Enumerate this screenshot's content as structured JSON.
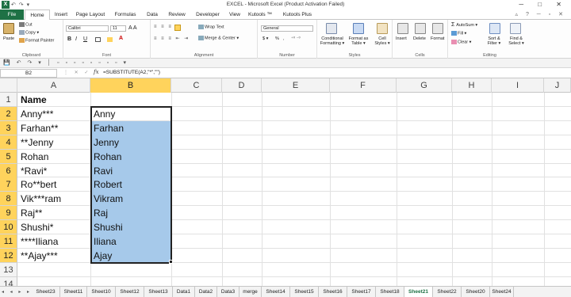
{
  "window": {
    "title": "EXCEL - Microsoft Excel (Product Activation Failed)",
    "quick_access": "↶ ↷ ▾",
    "controls": "─ □ ✕"
  },
  "tabs": [
    "File",
    "Home",
    "Insert",
    "Page Layout",
    "Formulas",
    "Data",
    "Review",
    "Developer",
    "View",
    "Kutools ™",
    "Kutools Plus"
  ],
  "active_tab": "Home",
  "ribbon": {
    "clipboard": {
      "paste": "Paste",
      "cut": "Cut",
      "copy": "Copy ▾",
      "format_painter": "Format Painter",
      "label": "Clipboard"
    },
    "font": {
      "name": "Calibri",
      "size": "11",
      "label": "Font",
      "bold": "B",
      "italic": "I",
      "underline": "U"
    },
    "alignment": {
      "wrap_text": "Wrap Text",
      "merge_center": "Merge & Center ▾",
      "label": "Alignment"
    },
    "number": {
      "format": "General",
      "label": "Number",
      "currency": "$ ▾",
      "percent": "%",
      "comma": ","
    },
    "styles": {
      "conditional": "Conditional Formatting ▾",
      "format_table": "Format as Table ▾",
      "cell_styles": "Cell Styles ▾",
      "label": "Styles"
    },
    "cells": {
      "insert": "Insert",
      "delete": "Delete",
      "format": "Format",
      "label": "Cells"
    },
    "editing": {
      "autosum": "AutoSum ▾",
      "fill": "Fill ▾",
      "clear": "Clear ▾",
      "sort_filter": "Sort & Filter ▾",
      "find_select": "Find & Select ▾",
      "label": "Editing"
    }
  },
  "formula_bar": {
    "name_box": "B2",
    "fx": "fx",
    "formula": "=SUBSTITUTE(A2,\"*\",\"\")"
  },
  "columns": [
    "A",
    "B",
    "C",
    "D",
    "E",
    "F",
    "G",
    "H",
    "I",
    "J"
  ],
  "rows": [
    "1",
    "2",
    "3",
    "4",
    "5",
    "6",
    "7",
    "8",
    "9",
    "10",
    "11",
    "12",
    "13",
    "14"
  ],
  "cells": {
    "A": [
      "Name",
      "Anny***",
      "Farhan**",
      "**Jenny",
      "Rohan",
      "*Ravi*",
      "Ro**bert",
      "Vik***ram",
      "Raj**",
      "Shushi*",
      "****Iliana",
      "**Ajay***",
      "",
      ""
    ],
    "B": [
      "",
      "Anny",
      "Farhan",
      "Jenny",
      "Rohan",
      "Ravi",
      "Robert",
      "Vikram",
      "Raj",
      "Shushi",
      "Iliana",
      "Ajay",
      "",
      ""
    ]
  },
  "sheet_tabs": [
    "Sheet23",
    "Sheet11",
    "Sheet10",
    "Sheet12",
    "Sheet13",
    "Data1",
    "Data2",
    "Data3",
    "merge",
    "Sheet14",
    "Sheet15",
    "Sheet16",
    "Sheet17",
    "Sheet18",
    "Sheet21",
    "Sheet22",
    "Sheet20",
    "Sheet24"
  ],
  "active_sheet": "Sheet21",
  "colors": {
    "excel_green": "#1e7145",
    "selection_fill": "#a6c9ea",
    "header_highlight": "#ffd35c"
  }
}
